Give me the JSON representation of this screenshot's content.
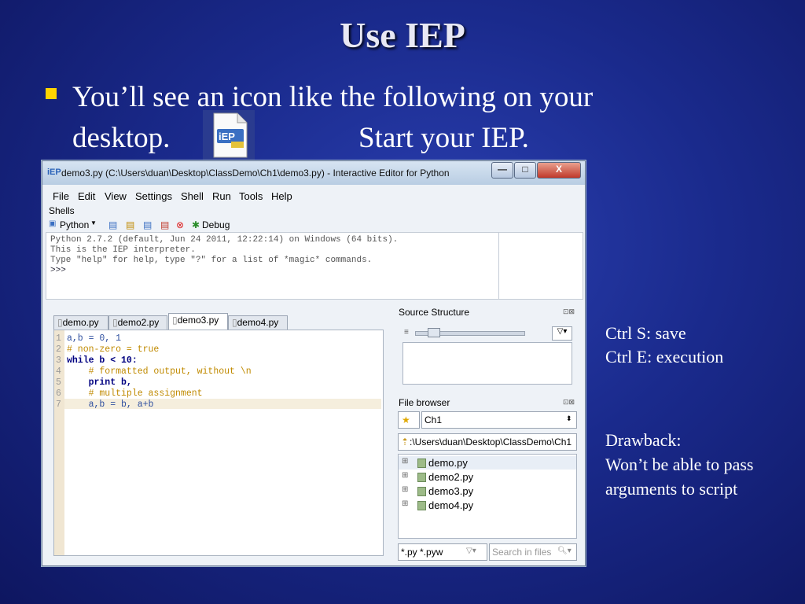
{
  "slide": {
    "title": "Use IEP",
    "bullet_line1": "You’ll see an icon like the following on your",
    "bullet_line2": "desktop.",
    "bullet_start": "Start your IEP.",
    "icon_label": "iEP",
    "note_ctrl_s": "Ctrl S: save",
    "note_ctrl_e": "Ctrl E: execution",
    "note_drawback": "Drawback:",
    "note_drawback_1": "Won’t be able to pass",
    "note_drawback_2": "arguments to script"
  },
  "window": {
    "app_icon": "iEP",
    "title": "demo3.py (C:\\Users\\duan\\Desktop\\ClassDemo\\Ch1\\demo3.py) - Interactive Editor for Python",
    "minimize": "—",
    "maximize": "□",
    "close": "X",
    "menu": [
      "File",
      "Edit",
      "View",
      "Settings",
      "Shell",
      "Run",
      "Tools",
      "Help"
    ],
    "shells_label": "Shells",
    "shell_tab": "Python",
    "debug_label": "Debug",
    "shell_lines": [
      "Python 2.7.2 (default, Jun 24 2011, 12:22:14) on Windows (64 bits).",
      "This is the IEP interpreter.",
      "Type \"help\" for help, type \"?\" for a list of *magic* commands.",
      ">>>"
    ],
    "tabs": [
      "demo.py",
      "demo2.py",
      "demo3.py",
      "demo4.py"
    ],
    "code_lines": [
      {
        "n": "1",
        "text": "a,b = 0, 1"
      },
      {
        "n": "2",
        "text": "# non-zero = true"
      },
      {
        "n": "3",
        "text": "while b < 10:"
      },
      {
        "n": "4",
        "text": "    # formatted output, without \\n"
      },
      {
        "n": "5",
        "text": "    print b,"
      },
      {
        "n": "6",
        "text": "    # multiple assignment"
      },
      {
        "n": "7",
        "text": "    a,b = b, a+b"
      }
    ],
    "source_structure_title": "Source Structure",
    "file_browser_title": "File browser",
    "project": "Ch1",
    "path": ":\\Users\\duan\\Desktop\\ClassDemo\\Ch1",
    "files": [
      "demo.py",
      "demo2.py",
      "demo3.py",
      "demo4.py"
    ],
    "filter": "*.py *.pyw",
    "search_placeholder": "Search in files",
    "colors": {
      "comment": "#c08a00",
      "keyword": "#000080",
      "number": "#2a8c2a",
      "default": "#3050a0"
    }
  }
}
